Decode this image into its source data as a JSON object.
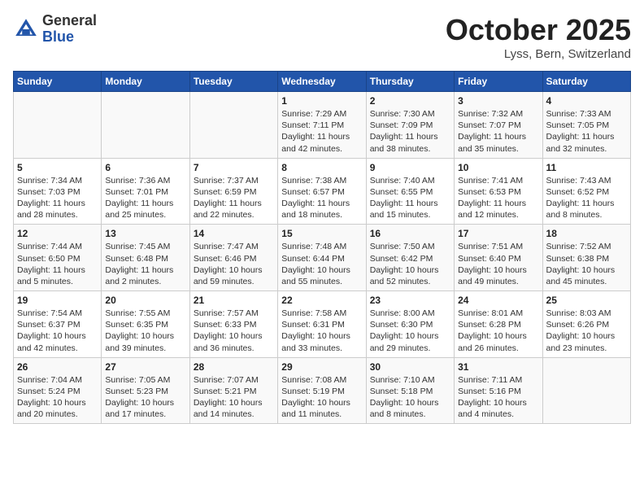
{
  "header": {
    "logo_general": "General",
    "logo_blue": "Blue",
    "month": "October 2025",
    "location": "Lyss, Bern, Switzerland"
  },
  "days_of_week": [
    "Sunday",
    "Monday",
    "Tuesday",
    "Wednesday",
    "Thursday",
    "Friday",
    "Saturday"
  ],
  "weeks": [
    [
      {
        "day": "",
        "info": ""
      },
      {
        "day": "",
        "info": ""
      },
      {
        "day": "",
        "info": ""
      },
      {
        "day": "1",
        "info": "Sunrise: 7:29 AM\nSunset: 7:11 PM\nDaylight: 11 hours and 42 minutes."
      },
      {
        "day": "2",
        "info": "Sunrise: 7:30 AM\nSunset: 7:09 PM\nDaylight: 11 hours and 38 minutes."
      },
      {
        "day": "3",
        "info": "Sunrise: 7:32 AM\nSunset: 7:07 PM\nDaylight: 11 hours and 35 minutes."
      },
      {
        "day": "4",
        "info": "Sunrise: 7:33 AM\nSunset: 7:05 PM\nDaylight: 11 hours and 32 minutes."
      }
    ],
    [
      {
        "day": "5",
        "info": "Sunrise: 7:34 AM\nSunset: 7:03 PM\nDaylight: 11 hours and 28 minutes."
      },
      {
        "day": "6",
        "info": "Sunrise: 7:36 AM\nSunset: 7:01 PM\nDaylight: 11 hours and 25 minutes."
      },
      {
        "day": "7",
        "info": "Sunrise: 7:37 AM\nSunset: 6:59 PM\nDaylight: 11 hours and 22 minutes."
      },
      {
        "day": "8",
        "info": "Sunrise: 7:38 AM\nSunset: 6:57 PM\nDaylight: 11 hours and 18 minutes."
      },
      {
        "day": "9",
        "info": "Sunrise: 7:40 AM\nSunset: 6:55 PM\nDaylight: 11 hours and 15 minutes."
      },
      {
        "day": "10",
        "info": "Sunrise: 7:41 AM\nSunset: 6:53 PM\nDaylight: 11 hours and 12 minutes."
      },
      {
        "day": "11",
        "info": "Sunrise: 7:43 AM\nSunset: 6:52 PM\nDaylight: 11 hours and 8 minutes."
      }
    ],
    [
      {
        "day": "12",
        "info": "Sunrise: 7:44 AM\nSunset: 6:50 PM\nDaylight: 11 hours and 5 minutes."
      },
      {
        "day": "13",
        "info": "Sunrise: 7:45 AM\nSunset: 6:48 PM\nDaylight: 11 hours and 2 minutes."
      },
      {
        "day": "14",
        "info": "Sunrise: 7:47 AM\nSunset: 6:46 PM\nDaylight: 10 hours and 59 minutes."
      },
      {
        "day": "15",
        "info": "Sunrise: 7:48 AM\nSunset: 6:44 PM\nDaylight: 10 hours and 55 minutes."
      },
      {
        "day": "16",
        "info": "Sunrise: 7:50 AM\nSunset: 6:42 PM\nDaylight: 10 hours and 52 minutes."
      },
      {
        "day": "17",
        "info": "Sunrise: 7:51 AM\nSunset: 6:40 PM\nDaylight: 10 hours and 49 minutes."
      },
      {
        "day": "18",
        "info": "Sunrise: 7:52 AM\nSunset: 6:38 PM\nDaylight: 10 hours and 45 minutes."
      }
    ],
    [
      {
        "day": "19",
        "info": "Sunrise: 7:54 AM\nSunset: 6:37 PM\nDaylight: 10 hours and 42 minutes."
      },
      {
        "day": "20",
        "info": "Sunrise: 7:55 AM\nSunset: 6:35 PM\nDaylight: 10 hours and 39 minutes."
      },
      {
        "day": "21",
        "info": "Sunrise: 7:57 AM\nSunset: 6:33 PM\nDaylight: 10 hours and 36 minutes."
      },
      {
        "day": "22",
        "info": "Sunrise: 7:58 AM\nSunset: 6:31 PM\nDaylight: 10 hours and 33 minutes."
      },
      {
        "day": "23",
        "info": "Sunrise: 8:00 AM\nSunset: 6:30 PM\nDaylight: 10 hours and 29 minutes."
      },
      {
        "day": "24",
        "info": "Sunrise: 8:01 AM\nSunset: 6:28 PM\nDaylight: 10 hours and 26 minutes."
      },
      {
        "day": "25",
        "info": "Sunrise: 8:03 AM\nSunset: 6:26 PM\nDaylight: 10 hours and 23 minutes."
      }
    ],
    [
      {
        "day": "26",
        "info": "Sunrise: 7:04 AM\nSunset: 5:24 PM\nDaylight: 10 hours and 20 minutes."
      },
      {
        "day": "27",
        "info": "Sunrise: 7:05 AM\nSunset: 5:23 PM\nDaylight: 10 hours and 17 minutes."
      },
      {
        "day": "28",
        "info": "Sunrise: 7:07 AM\nSunset: 5:21 PM\nDaylight: 10 hours and 14 minutes."
      },
      {
        "day": "29",
        "info": "Sunrise: 7:08 AM\nSunset: 5:19 PM\nDaylight: 10 hours and 11 minutes."
      },
      {
        "day": "30",
        "info": "Sunrise: 7:10 AM\nSunset: 5:18 PM\nDaylight: 10 hours and 8 minutes."
      },
      {
        "day": "31",
        "info": "Sunrise: 7:11 AM\nSunset: 5:16 PM\nDaylight: 10 hours and 4 minutes."
      },
      {
        "day": "",
        "info": ""
      }
    ]
  ]
}
